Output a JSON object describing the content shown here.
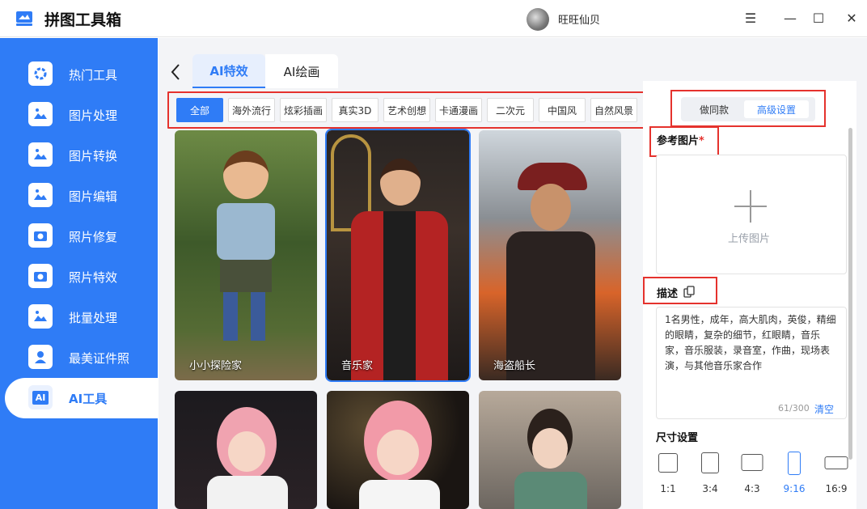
{
  "app": {
    "title": "拼图工具箱",
    "user_name": "旺旺仙贝"
  },
  "window_controls": {
    "menu": "☰",
    "minimize": "—",
    "maximize": "☐",
    "close": "✕"
  },
  "sidebar": {
    "items": [
      {
        "label": "热门工具",
        "icon": "hot-tools-icon"
      },
      {
        "label": "图片处理",
        "icon": "image-process-icon"
      },
      {
        "label": "图片转换",
        "icon": "image-convert-icon"
      },
      {
        "label": "图片编辑",
        "icon": "image-edit-icon"
      },
      {
        "label": "照片修复",
        "icon": "photo-repair-icon"
      },
      {
        "label": "照片特效",
        "icon": "photo-effects-icon"
      },
      {
        "label": "批量处理",
        "icon": "batch-icon"
      },
      {
        "label": "最美证件照",
        "icon": "id-photo-icon"
      },
      {
        "label": "AI工具",
        "icon": "ai-tools-icon",
        "active": true
      }
    ],
    "ai_badge": "AI"
  },
  "tabs": {
    "effects": "AI特效",
    "drawing": "AI绘画",
    "active": "AI特效"
  },
  "categories": [
    "全部",
    "海外流行",
    "炫彩插画",
    "真实3D",
    "艺术创想",
    "卡通漫画",
    "二次元",
    "中国风",
    "自然风景"
  ],
  "active_category": "全部",
  "cards": [
    {
      "label": "小小探险家"
    },
    {
      "label": "音乐家",
      "selected": true
    },
    {
      "label": "海盗船长"
    },
    {
      "label": ""
    },
    {
      "label": ""
    },
    {
      "label": ""
    }
  ],
  "panel": {
    "mode_same": "做同款",
    "mode_advanced": "高级设置",
    "ref_label": "参考图片",
    "required_mark": "*",
    "upload_text": "上传图片",
    "desc_label": "描述",
    "description": "1名男性，成年，高大肌肉，英俊，精细的眼睛，复杂的细节，红眼睛，音乐家，音乐服装，录音室，作曲，现场表演，与其他音乐家合作",
    "char_count": "61/300",
    "clear": "清空",
    "size_title": "尺寸设置",
    "ratios": [
      "1:1",
      "3:4",
      "4:3",
      "9:16",
      "16:9"
    ],
    "active_ratio": "9:16"
  },
  "colors": {
    "brand": "#2f7cf6",
    "highlight": "#e5322d"
  }
}
